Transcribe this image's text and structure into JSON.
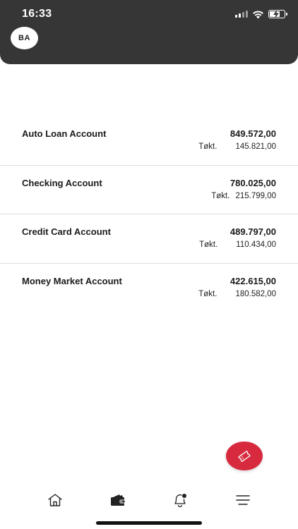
{
  "status_bar": {
    "time": "16:33"
  },
  "header": {
    "avatar_initials": "BA"
  },
  "accounts": [
    {
      "name": "Auto Loan Account",
      "amount": "849.572,00",
      "sub_label": "Tøkt.",
      "sub_value": "145.821,00"
    },
    {
      "name": "Checking Account",
      "amount": "780.025,00",
      "sub_label": "Tøkt.",
      "sub_value": "215.799,00"
    },
    {
      "name": "Credit Card Account",
      "amount": "489.797,00",
      "sub_label": "Tøkt.",
      "sub_value": "110.434,00"
    },
    {
      "name": "Money Market Account",
      "amount": "422.615,00",
      "sub_label": "Tøkt.",
      "sub_value": "180.582,00"
    }
  ],
  "fab": {
    "icon": "ticket-icon",
    "color": "#d72a3e"
  },
  "bottom_nav": [
    {
      "icon": "home-icon",
      "active": false
    },
    {
      "icon": "wallet-icon",
      "active": true
    },
    {
      "icon": "notification-bell-icon",
      "active": false
    },
    {
      "icon": "menu-icon",
      "active": false
    }
  ],
  "colors": {
    "header_bg": "#363636",
    "accent": "#d72a3e",
    "divider": "#dedede"
  }
}
